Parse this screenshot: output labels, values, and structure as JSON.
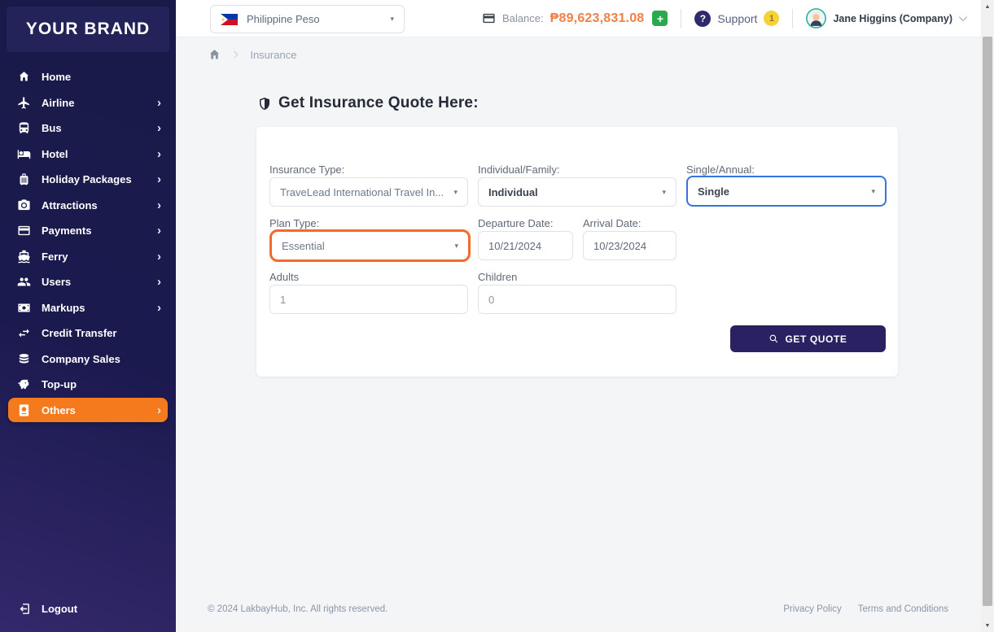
{
  "brand": "YOUR BRAND",
  "topbar": {
    "currency": "Philippine Peso",
    "balance_label": "Balance:",
    "balance_amount": "₱89,623,831.08",
    "add_funds": "+",
    "support_icon": "?",
    "support_label": "Support",
    "support_badge": "1",
    "user_name": "Jane Higgins (Company)"
  },
  "sidebar": {
    "items": [
      {
        "label": "Home",
        "icon": "home-icon",
        "chevron": false,
        "active": false
      },
      {
        "label": "Airline",
        "icon": "airplane-icon",
        "chevron": true,
        "active": false
      },
      {
        "label": "Bus",
        "icon": "bus-icon",
        "chevron": true,
        "active": false
      },
      {
        "label": "Hotel",
        "icon": "bed-icon",
        "chevron": true,
        "active": false
      },
      {
        "label": "Holiday Packages",
        "icon": "luggage-icon",
        "chevron": true,
        "active": false
      },
      {
        "label": "Attractions",
        "icon": "camera-icon",
        "chevron": true,
        "active": false
      },
      {
        "label": "Payments",
        "icon": "credit-card-icon",
        "chevron": true,
        "active": false
      },
      {
        "label": "Ferry",
        "icon": "ship-icon",
        "chevron": true,
        "active": false
      },
      {
        "label": "Users",
        "icon": "users-icon",
        "chevron": true,
        "active": false
      },
      {
        "label": "Markups",
        "icon": "banknote-icon",
        "chevron": true,
        "active": false
      },
      {
        "label": "Credit Transfer",
        "icon": "transfer-icon",
        "chevron": false,
        "active": false
      },
      {
        "label": "Company Sales",
        "icon": "coins-icon",
        "chevron": false,
        "active": false
      },
      {
        "label": "Top-up",
        "icon": "piggy-bank-icon",
        "chevron": false,
        "active": false
      },
      {
        "label": "Others",
        "icon": "passport-icon",
        "chevron": true,
        "active": true
      }
    ],
    "logout_label": "Logout"
  },
  "breadcrumb": {
    "current": "Insurance"
  },
  "main": {
    "title": "Get Insurance Quote Here:",
    "form": {
      "insurance_type_label": "Insurance Type:",
      "insurance_type_value": "TraveLead International Travel In...",
      "individual_family_label": "Individual/Family:",
      "individual_family_value": "Individual",
      "single_annual_label": "Single/Annual:",
      "single_annual_value": "Single",
      "plan_type_label": "Plan Type:",
      "plan_type_value": "Essential",
      "departure_label": "Departure Date:",
      "departure_value": "10/21/2024",
      "arrival_label": "Arrival Date:",
      "arrival_value": "10/23/2024",
      "adults_label": "Adults",
      "adults_value": "1",
      "children_label": "Children",
      "children_value": "0",
      "submit_label": "GET QUOTE"
    }
  },
  "footer": {
    "copyright": "© 2024 LakbayHub, Inc. All rights reserved.",
    "links": [
      "Privacy Policy",
      "Terms and Conditions"
    ]
  },
  "colors": {
    "accent_orange": "#f5791d",
    "highlight_orange": "#f26a2e",
    "highlight_blue": "#3574e0",
    "balance_orange": "#ef8147",
    "success_green": "#2ca94f",
    "badge_yellow": "#f6d235",
    "navy": "#2a2163"
  }
}
